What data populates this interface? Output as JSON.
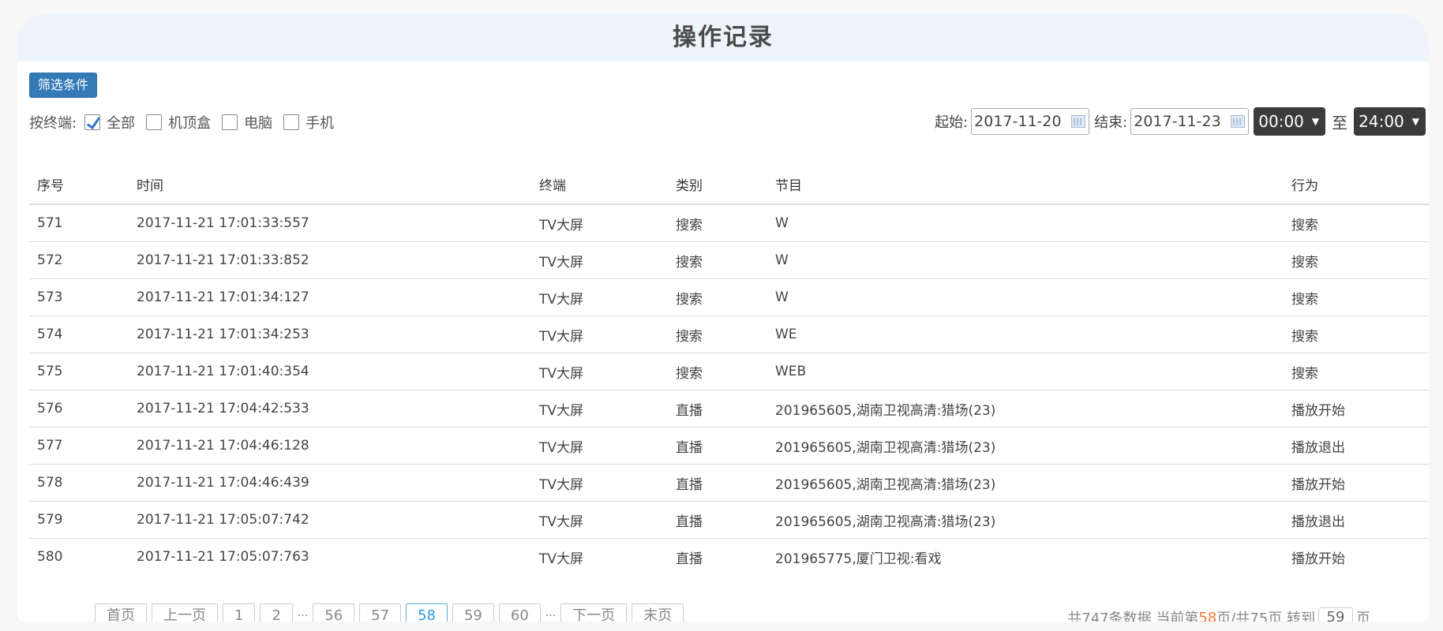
{
  "page": {
    "title": "操作记录"
  },
  "filter": {
    "button_label": "筛选条件",
    "terminal_label": "按终端:",
    "options": [
      {
        "label": "全部",
        "checked": true
      },
      {
        "label": "机顶盒",
        "checked": false
      },
      {
        "label": "电脑",
        "checked": false
      },
      {
        "label": "手机",
        "checked": false
      }
    ],
    "start_label": "起始:",
    "start_date": "2017-11-20",
    "end_label": "结束:",
    "end_date": "2017-11-23",
    "time_from": "00:00",
    "to_label": "至",
    "time_to": "24:00"
  },
  "table": {
    "headers": [
      "序号",
      "时间",
      "终端",
      "类别",
      "节目",
      "行为"
    ],
    "rows": [
      [
        "571",
        "2017-11-21 17:01:33:557",
        "TV大屏",
        "搜索",
        "W",
        "搜索"
      ],
      [
        "572",
        "2017-11-21 17:01:33:852",
        "TV大屏",
        "搜索",
        "W",
        "搜索"
      ],
      [
        "573",
        "2017-11-21 17:01:34:127",
        "TV大屏",
        "搜索",
        "W",
        "搜索"
      ],
      [
        "574",
        "2017-11-21 17:01:34:253",
        "TV大屏",
        "搜索",
        "WE",
        "搜索"
      ],
      [
        "575",
        "2017-11-21 17:01:40:354",
        "TV大屏",
        "搜索",
        "WEB",
        "搜索"
      ],
      [
        "576",
        "2017-11-21 17:04:42:533",
        "TV大屏",
        "直播",
        "201965605,湖南卫视高清:猎场(23)",
        "播放开始"
      ],
      [
        "577",
        "2017-11-21 17:04:46:128",
        "TV大屏",
        "直播",
        "201965605,湖南卫视高清:猎场(23)",
        "播放退出"
      ],
      [
        "578",
        "2017-11-21 17:04:46:439",
        "TV大屏",
        "直播",
        "201965605,湖南卫视高清:猎场(23)",
        "播放开始"
      ],
      [
        "579",
        "2017-11-21 17:05:07:742",
        "TV大屏",
        "直播",
        "201965605,湖南卫视高清:猎场(23)",
        "播放退出"
      ],
      [
        "580",
        "2017-11-21 17:05:07:763",
        "TV大屏",
        "直播",
        "201965775,厦门卫视:看戏",
        "播放开始"
      ]
    ]
  },
  "pagination": {
    "first": "首页",
    "prev": "上一页",
    "pages_before": [
      "1",
      "2"
    ],
    "ellipsis": "···",
    "pages_middle": [
      "56",
      "57",
      "58",
      "59",
      "60"
    ],
    "current": "58",
    "next": "下一页",
    "last": "末页",
    "summary_prefix": "共747条数据 当前第",
    "current_page": "58",
    "summary_mid": "页/共75页 转到",
    "jump_value": "59",
    "summary_suffix": "页"
  }
}
